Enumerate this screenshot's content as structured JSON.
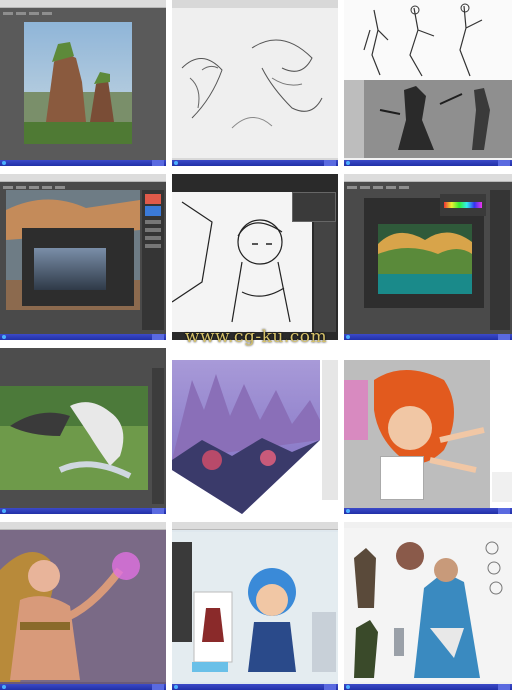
{
  "page": {
    "watermark": "www.cg-ku.com"
  },
  "colors": {
    "photoshop_ui": "#5a5a5a",
    "taskbar": "#2130a8",
    "menubar": "#dcdcdc",
    "watermark": "#d6c26a"
  },
  "tiles": [
    {
      "id": "tile-1",
      "subject": "rock-pillar-landscape-painting"
    },
    {
      "id": "tile-2",
      "subject": "creature-line-sketches"
    },
    {
      "id": "tile-3",
      "subject": "armored-warrior-concept-sketches"
    },
    {
      "id": "tile-4",
      "subject": "photoshop-landscape-workspace"
    },
    {
      "id": "tile-5",
      "subject": "manga-girl-line-art"
    },
    {
      "id": "tile-6",
      "subject": "jungle-environment-workspace"
    },
    {
      "id": "tile-7",
      "subject": "green-forest-arm-study"
    },
    {
      "id": "tile-8",
      "subject": "purple-fantasy-mountain-village"
    },
    {
      "id": "tile-9",
      "subject": "orange-hair-chibi-character-sheet"
    },
    {
      "id": "tile-10",
      "subject": "fantasy-female-mage-painting"
    },
    {
      "id": "tile-11",
      "subject": "blue-hair-chibi-warrior"
    },
    {
      "id": "tile-12",
      "subject": "armored-warrior-character-sheet"
    }
  ]
}
